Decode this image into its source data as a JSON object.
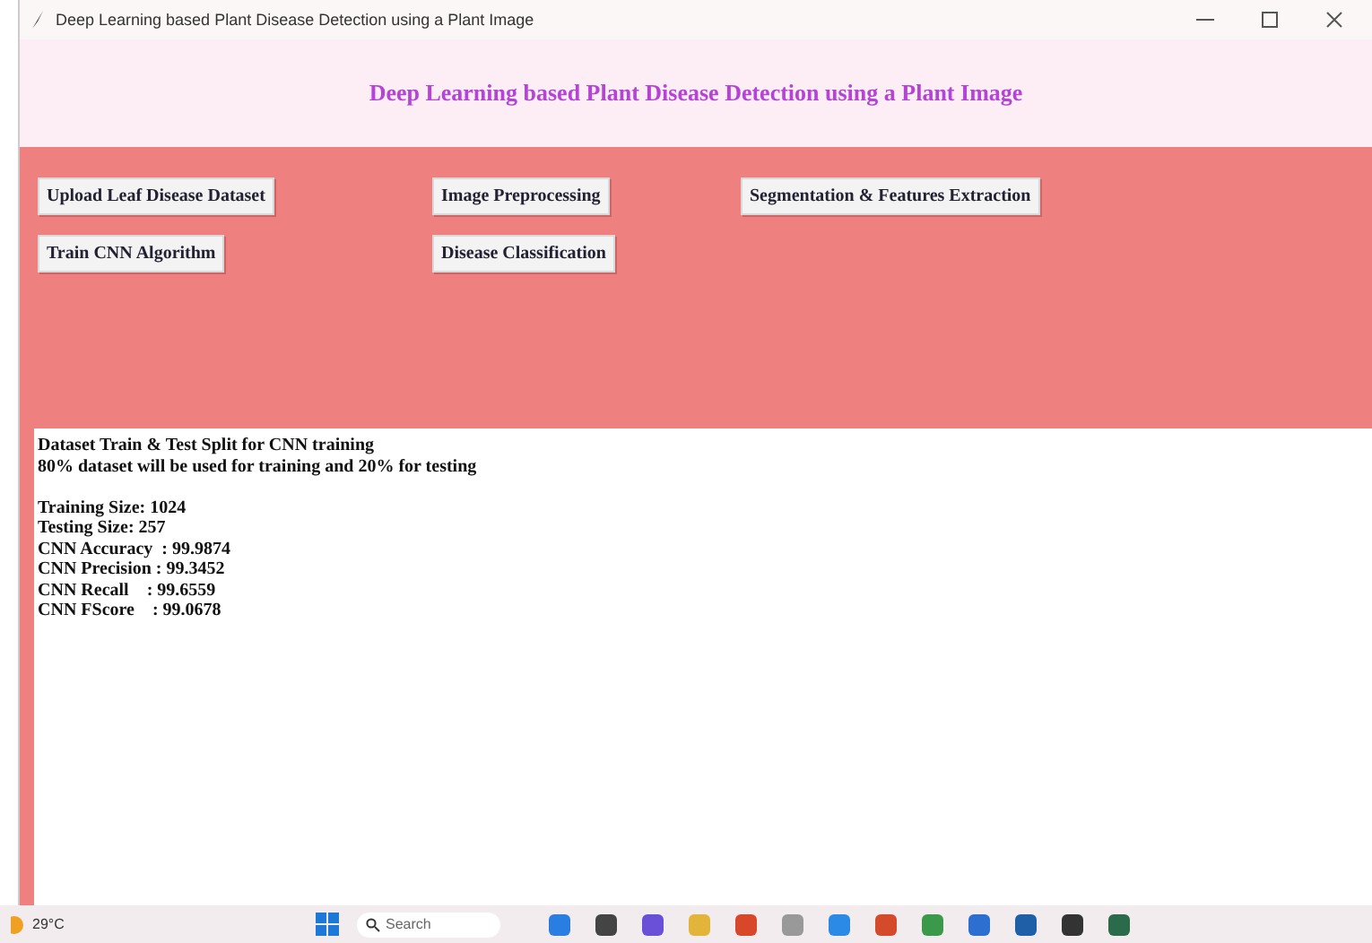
{
  "window": {
    "title": "Deep Learning based Plant Disease Detection using a Plant Image"
  },
  "heading": "Deep Learning based Plant Disease Detection using a Plant Image",
  "buttons": [
    {
      "label": "Upload Leaf Disease Dataset"
    },
    {
      "label": "Image Preprocessing"
    },
    {
      "label": "Segmentation & Features Extraction"
    },
    {
      "label": "Train CNN Algorithm"
    },
    {
      "label": "Disease Classification"
    }
  ],
  "output_paragraphs": [
    [
      "Dataset Train & Test Split for CNN training",
      "80% dataset will be used for training and 20% for testing"
    ],
    [
      "Training Size: 1024",
      "Testing Size: 257",
      "CNN Accuracy  : 99.9874",
      "CNN Precision : 99.3452",
      "CNN Recall    : 99.6559",
      "CNN FScore    : 99.0678"
    ]
  ],
  "taskbar": {
    "weather": "29°C",
    "search_placeholder": "Search"
  }
}
